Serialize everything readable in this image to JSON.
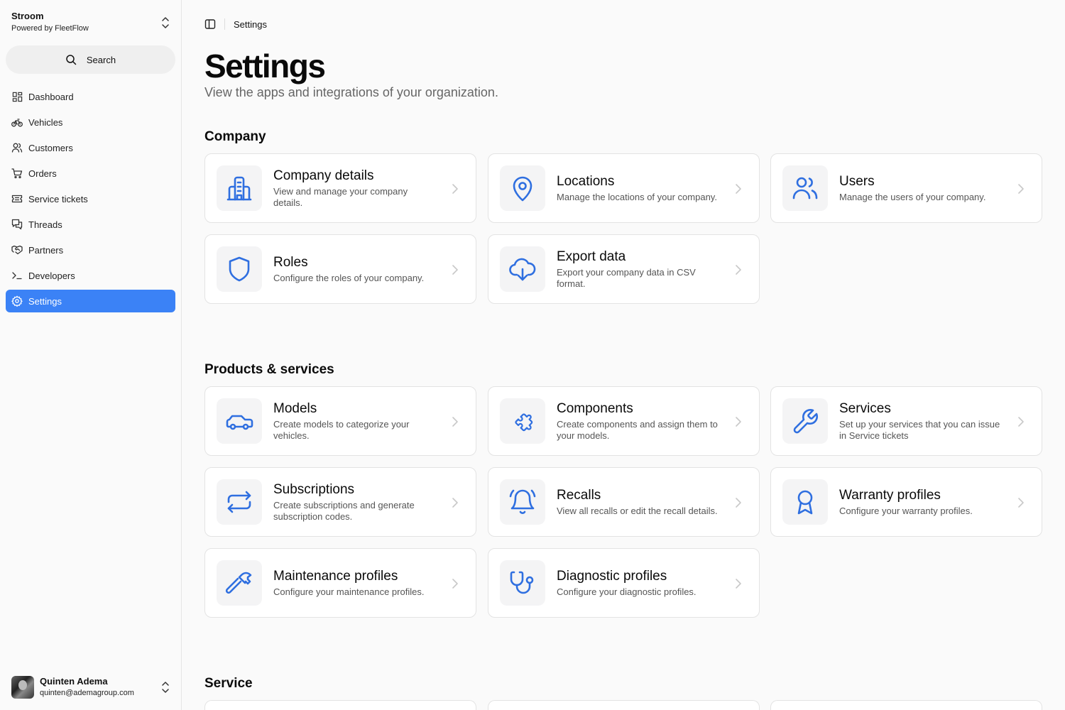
{
  "org": {
    "name": "Stroom",
    "subtitle": "Powered by FleetFlow"
  },
  "search": {
    "label": "Search"
  },
  "nav": [
    {
      "label": "Dashboard",
      "icon": "dashboard-icon"
    },
    {
      "label": "Vehicles",
      "icon": "bike-icon"
    },
    {
      "label": "Customers",
      "icon": "users-icon"
    },
    {
      "label": "Orders",
      "icon": "cart-icon"
    },
    {
      "label": "Service tickets",
      "icon": "ticket-icon"
    },
    {
      "label": "Threads",
      "icon": "messages-icon"
    },
    {
      "label": "Partners",
      "icon": "handshake-icon"
    },
    {
      "label": "Developers",
      "icon": "terminal-icon"
    },
    {
      "label": "Settings",
      "icon": "gear-icon",
      "active": true
    }
  ],
  "user": {
    "name": "Quinten Adema",
    "email": "quinten@ademagroup.com"
  },
  "breadcrumb": {
    "current": "Settings"
  },
  "page": {
    "title": "Settings",
    "subtitle": "View the apps and integrations of your organization."
  },
  "sections": {
    "company": {
      "title": "Company",
      "cards": [
        {
          "title": "Company details",
          "desc": "View and manage your company details.",
          "icon": "building-icon"
        },
        {
          "title": "Locations",
          "desc": "Manage the locations of your company.",
          "icon": "map-pin-icon"
        },
        {
          "title": "Users",
          "desc": "Manage the users of your company.",
          "icon": "users-icon"
        },
        {
          "title": "Roles",
          "desc": "Configure the roles of your company.",
          "icon": "shield-icon"
        },
        {
          "title": "Export data",
          "desc": "Export your company data in CSV format.",
          "icon": "cloud-download-icon"
        }
      ]
    },
    "products": {
      "title": "Products & services",
      "cards": [
        {
          "title": "Models",
          "desc": "Create models to categorize your vehicles.",
          "icon": "car-icon"
        },
        {
          "title": "Components",
          "desc": "Create components and assign them to your models.",
          "icon": "puzzle-icon"
        },
        {
          "title": "Services",
          "desc": "Set up your services that you can issue in Service tickets",
          "icon": "wrench-icon"
        },
        {
          "title": "Subscriptions",
          "desc": "Create subscriptions and generate subscription codes.",
          "icon": "repeat-icon"
        },
        {
          "title": "Recalls",
          "desc": "View all recalls or edit the recall details.",
          "icon": "bell-icon"
        },
        {
          "title": "Warranty profiles",
          "desc": "Configure your warranty profiles.",
          "icon": "award-icon"
        },
        {
          "title": "Maintenance profiles",
          "desc": "Configure your maintenance profiles.",
          "icon": "hammer-icon"
        },
        {
          "title": "Diagnostic profiles",
          "desc": "Configure your diagnostic profiles.",
          "icon": "stethoscope-icon"
        }
      ]
    },
    "service": {
      "title": "Service"
    }
  },
  "colors": {
    "accent": "#3b82f6",
    "icon_blue": "#2f6fe0"
  }
}
